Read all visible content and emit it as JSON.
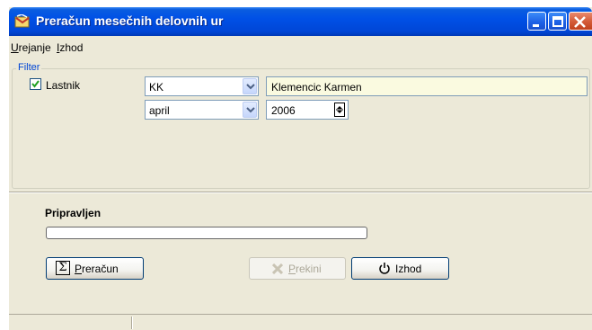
{
  "window": {
    "title": "Preračun mesečnih delovnih ur",
    "controls": [
      "minimize-icon",
      "maximize-icon",
      "close-icon"
    ]
  },
  "menu": {
    "edit": {
      "accel": "U",
      "rest": "rejanje"
    },
    "exit": {
      "accel": "I",
      "rest": "zhod"
    }
  },
  "filter": {
    "legend": "Filter",
    "owner_checkbox_label": "Lastnik",
    "owner_checked": true,
    "owner_code": "KK",
    "owner_name": "Klemencic Karmen",
    "month": "april",
    "year": "2006"
  },
  "status": {
    "text": "Pripravljen",
    "progress_percent": 0
  },
  "buttons": {
    "calculate": {
      "icon": "sigma-icon",
      "accel": "P",
      "rest": "reračun"
    },
    "abort": {
      "icon": "abort-icon",
      "accel": "P",
      "rest": "rekini",
      "enabled": false
    },
    "exit": {
      "icon": "power-icon",
      "label": "Izhod"
    }
  }
}
